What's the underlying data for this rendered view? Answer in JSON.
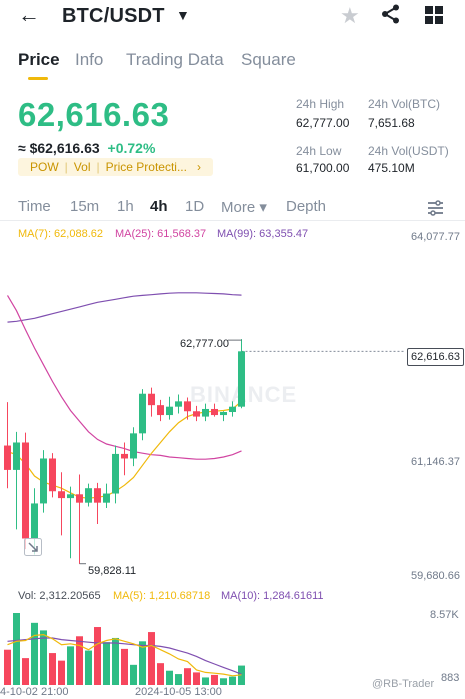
{
  "header": {
    "pair": "BTC/USDT",
    "back_icon": "arrow-left-icon",
    "caret_icon": "caret-down-icon",
    "favorite_icon": "star-icon",
    "share_icon": "share-icon",
    "menu_icon": "grid-icon"
  },
  "tabs": [
    {
      "label": "Price",
      "active": true
    },
    {
      "label": "Info"
    },
    {
      "label": "Trading Data"
    },
    {
      "label": "Square"
    }
  ],
  "ticker": {
    "last_price": "62,616.63",
    "usd_price": "≈ $62,616.63",
    "change": "+0.72%",
    "tags": [
      "POW",
      "Vol",
      "Price Protecti..."
    ],
    "tags_arrow": "›"
  },
  "stats": {
    "high_label": "24h High",
    "high_value": "62,777.00",
    "low_label": "24h Low",
    "low_value": "61,700.00",
    "vol_btc_label": "24h Vol(BTC)",
    "vol_btc_value": "7,651.68",
    "vol_usdt_label": "24h Vol(USDT)",
    "vol_usdt_value": "475.10M"
  },
  "intervals": [
    {
      "label": "Time"
    },
    {
      "label": "15m"
    },
    {
      "label": "1h"
    },
    {
      "label": "4h",
      "active": true
    },
    {
      "label": "1D"
    },
    {
      "label": "More ▾"
    },
    {
      "label": "Depth"
    }
  ],
  "chart_labels": {
    "ma7": "MA(7): 62,088.62",
    "ma25": "MA(25): 61,568.37",
    "ma99": "MA(99): 63,355.47",
    "y_top": "64,077.77",
    "y_mid": "61,146.37",
    "y_bottom": "59,680.66",
    "current_price": "62,616.63",
    "high_marker": "62,777.00",
    "low_marker": "59,828.11",
    "watermark": "BINANCE",
    "vol": "Vol: 2,312.20565",
    "vol_ma5": "MA(5): 1,210.68718",
    "vol_ma10": "MA(10): 1,284.61611",
    "vol_top": "8.57K",
    "vol_bottom": "883",
    "x_left": "4-10-02 21:00",
    "x_mid": "2024-10-05 13:00",
    "credit": "@RB-Trader"
  },
  "colors": {
    "up": "#2ebd85",
    "down": "#f6465d",
    "ma7": "#f0b90b",
    "ma25": "#d144a1",
    "ma99": "#7f4fb0",
    "accent": "#f0b90b"
  },
  "chart_data": {
    "type": "candlestick",
    "interval": "4h",
    "ylim": [
      59680.66,
      64077.77
    ],
    "candles": [
      {
        "o": 61380,
        "h": 61950,
        "l": 60820,
        "c": 61060
      },
      {
        "o": 61060,
        "h": 61560,
        "l": 60280,
        "c": 61420
      },
      {
        "o": 61420,
        "h": 61550,
        "l": 60020,
        "c": 60160
      },
      {
        "o": 60160,
        "h": 60820,
        "l": 59950,
        "c": 60620
      },
      {
        "o": 60620,
        "h": 61320,
        "l": 60500,
        "c": 61210
      },
      {
        "o": 61210,
        "h": 61280,
        "l": 60700,
        "c": 60780
      },
      {
        "o": 60780,
        "h": 61030,
        "l": 60200,
        "c": 60690
      },
      {
        "o": 60690,
        "h": 60840,
        "l": 59900,
        "c": 60740
      },
      {
        "o": 60740,
        "h": 61000,
        "l": 59828.11,
        "c": 60630
      },
      {
        "o": 60630,
        "h": 60880,
        "l": 60580,
        "c": 60820
      },
      {
        "o": 60820,
        "h": 60890,
        "l": 60350,
        "c": 60630
      },
      {
        "o": 60630,
        "h": 60880,
        "l": 60560,
        "c": 60750
      },
      {
        "o": 60750,
        "h": 61380,
        "l": 60620,
        "c": 61270
      },
      {
        "o": 61270,
        "h": 61420,
        "l": 60990,
        "c": 61210
      },
      {
        "o": 61210,
        "h": 61620,
        "l": 61110,
        "c": 61540
      },
      {
        "o": 61540,
        "h": 62120,
        "l": 61450,
        "c": 62060
      },
      {
        "o": 62060,
        "h": 62140,
        "l": 61760,
        "c": 61910
      },
      {
        "o": 61910,
        "h": 61980,
        "l": 61700,
        "c": 61780
      },
      {
        "o": 61780,
        "h": 62020,
        "l": 61720,
        "c": 61890
      },
      {
        "o": 61890,
        "h": 62050,
        "l": 61800,
        "c": 61960
      },
      {
        "o": 61960,
        "h": 62010,
        "l": 61720,
        "c": 61830
      },
      {
        "o": 61830,
        "h": 61900,
        "l": 61700,
        "c": 61760
      },
      {
        "o": 61760,
        "h": 61930,
        "l": 61700,
        "c": 61860
      },
      {
        "o": 61860,
        "h": 61930,
        "l": 61760,
        "c": 61780
      },
      {
        "o": 61780,
        "h": 61830,
        "l": 61700,
        "c": 61820
      },
      {
        "o": 61820,
        "h": 61960,
        "l": 61760,
        "c": 61890
      },
      {
        "o": 61890,
        "h": 62777.0,
        "l": 61870,
        "c": 62616.63
      }
    ],
    "ma7": [
      61300,
      61260,
      61140,
      60980,
      60900,
      60860,
      60820,
      60760,
      60700,
      60690,
      60700,
      60720,
      60780,
      60860,
      60960,
      61120,
      61280,
      61420,
      61560,
      61680,
      61760,
      61800,
      61820,
      61830,
      61840,
      61860,
      61960
    ],
    "ma25": [
      63350,
      63150,
      62900,
      62660,
      62440,
      62220,
      62020,
      61840,
      61700,
      61560,
      61460,
      61400,
      61370,
      61340,
      61300,
      61280,
      61260,
      61250,
      61230,
      61220,
      61210,
      61200,
      61200,
      61210,
      61230,
      61260,
      61310
    ],
    "ma99": [
      63000,
      63010,
      63030,
      63050,
      63080,
      63110,
      63140,
      63170,
      63200,
      63230,
      63260,
      63280,
      63300,
      63320,
      63340,
      63350,
      63360,
      63370,
      63380,
      63385,
      63385,
      63385,
      63380,
      63375,
      63370,
      63360,
      63355
    ],
    "volume": [
      4200,
      8570,
      3200,
      7400,
      6500,
      3800,
      2900,
      4600,
      5800,
      4100,
      6900,
      5100,
      5600,
      4300,
      2400,
      5200,
      6300,
      2600,
      1700,
      1300,
      2000,
      1500,
      900,
      1200,
      800,
      1000,
      2312.20565
    ],
    "vol_ma5": [
      4800,
      5200,
      5300,
      5900,
      6000,
      5500,
      4800,
      4900,
      4700,
      4200,
      4900,
      5300,
      5500,
      5200,
      4900,
      4500,
      4700,
      4200,
      3700,
      3100,
      2800,
      1800,
      1500,
      1400,
      1300,
      1100,
      1210.68718
    ],
    "vol_ma10": [
      5200,
      5300,
      5400,
      5500,
      5600,
      5600,
      5400,
      5300,
      5200,
      5100,
      5000,
      5000,
      5000,
      4900,
      4800,
      4700,
      4700,
      4600,
      4400,
      4100,
      3800,
      3400,
      2900,
      2500,
      2100,
      1700,
      1284.61611
    ],
    "vol_ylim": [
      0,
      8570
    ]
  }
}
